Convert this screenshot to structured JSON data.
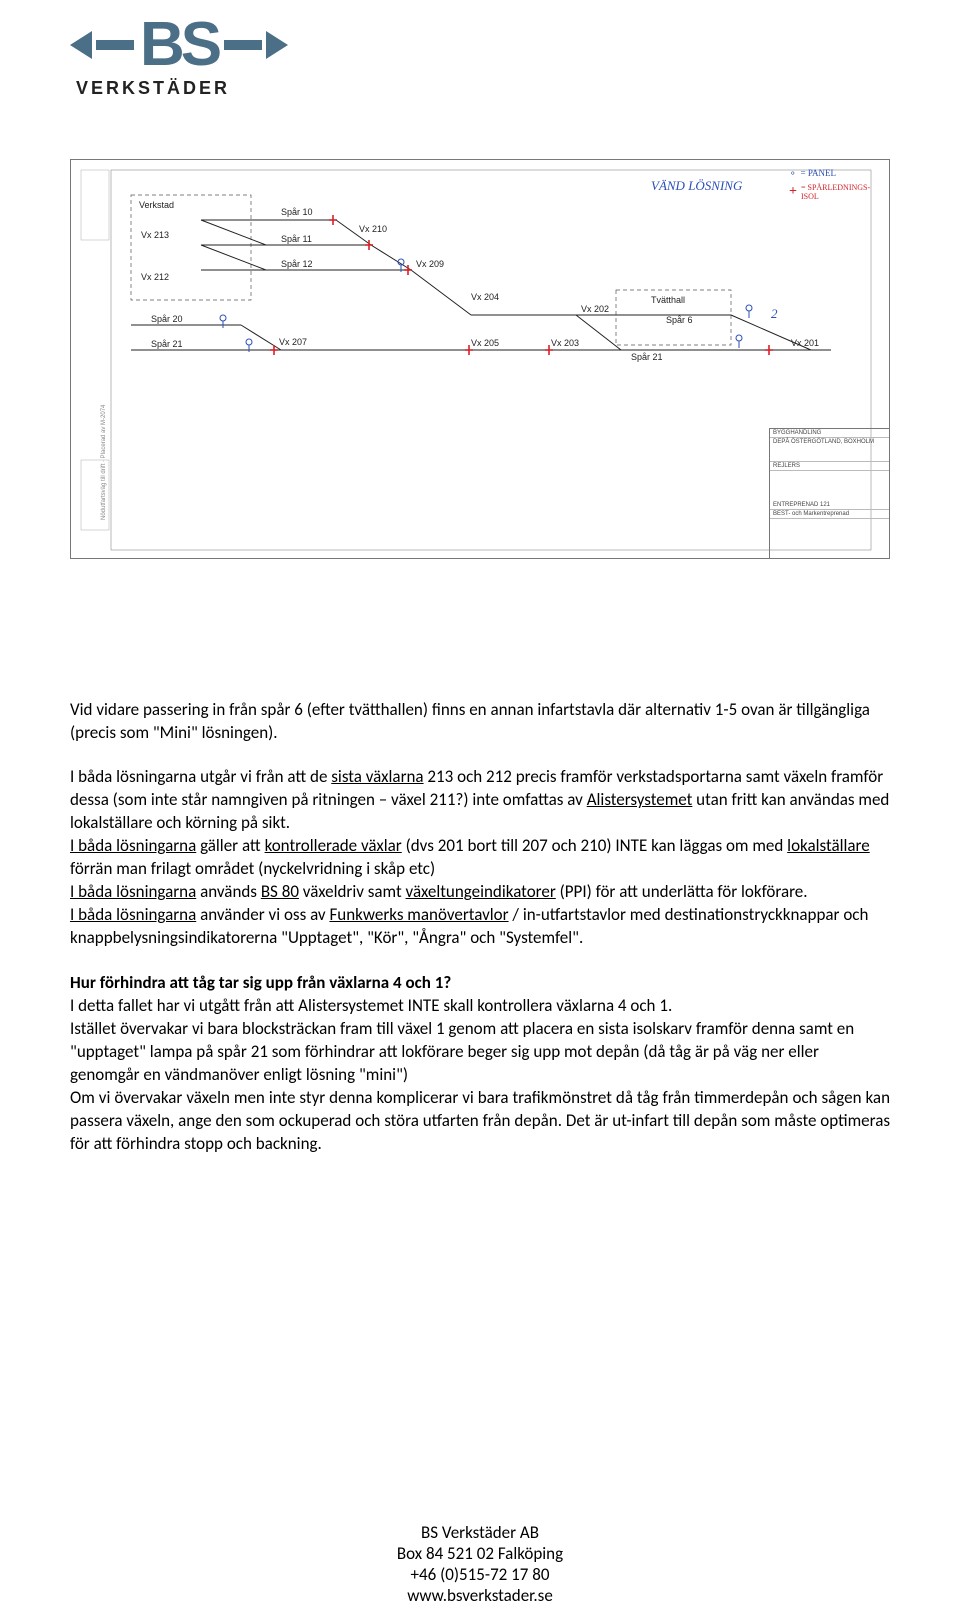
{
  "logo": {
    "bs": "BS",
    "sub": "VERKSTÄDER"
  },
  "diagram": {
    "handwritten_title": "VÄND LÖSNING",
    "labels": {
      "verkstad": "Verkstad",
      "vx213": "Vx 213",
      "vx212": "Vx 212",
      "spar10": "Spår 10",
      "spar11": "Spår 11",
      "spar12": "Spår 12",
      "vx210": "Vx 210",
      "vx209": "Vx 209",
      "vx204": "Vx 204",
      "spar20": "Spår 20",
      "spar21": "Spår 21",
      "vx207": "Vx 207",
      "vx205": "Vx 205",
      "vx203": "Vx 203",
      "vx202": "Vx 202",
      "tvatthall": "Tvätthall",
      "spar6": "Spår 6",
      "spar21b": "Spår 21",
      "vx201": "Vx 201",
      "two": "2"
    },
    "legend": {
      "panel_sym": "⚬",
      "panel": "= PANEL",
      "iso_sym": "+",
      "iso": "= SPÅRLEDNINGS-ISOL"
    },
    "titleblock": {
      "l1": "BYGGHANDLING",
      "l2": "DEPÅ ÖSTERGÖTLAND, BOXHOLM",
      "l3": "REJLERS",
      "l4": "ENTREPRENAD 121",
      "l5": "BEST- och Markentreprenad"
    },
    "side_note_left": "Nödutfartsväg till drift · Placerad av M-2074"
  },
  "para1": "Vid vidare passering in från spår 6 (efter tvätthallen) finns en annan infartstavla där alternativ 1-5 ovan är tillgängliga (precis som \"Mini\" lösningen).",
  "para2_a": "I båda lösningarna utgår vi från att de ",
  "para2_b": "sista växlarna",
  "para2_c": " 213 och 212 precis framför verkstadsportarna samt växeln framför dessa (som inte står namngiven på ritningen – växel 211?) inte omfattas av ",
  "para2_d": "Alistersystemet",
  "para2_e": " utan fritt kan användas med lokalställare och körning på sikt.",
  "para3_a": "I båda lösningarna",
  "para3_b": " gäller att ",
  "para3_c": "kontrollerade växlar",
  "para3_d": " (dvs 201 bort till 207 och 210) INTE kan läggas om med ",
  "para3_e": "lokalställare",
  "para3_f": " förrän man frilagt området (nyckelvridning i skåp etc)",
  "para4_a": "I båda lösningarna",
  "para4_b": " används ",
  "para4_c": "BS 80",
  "para4_d": " växeldriv samt ",
  "para4_e": "växeltungeindikatorer",
  "para4_f": " (PPI) för att underlätta för lokförare.",
  "para5_a": "I båda lösningarna",
  "para5_b": " använder vi oss av ",
  "para5_c": "Funkwerks manövertavlor",
  "para5_d": " / in-utfartstavlor med destinationstryckknappar och knappbelysningsindikatorerna \"Upptaget\", \"Kör\", \"Ångra\" och \"Systemfel\".",
  "heading": "Hur förhindra att tåg tar sig upp från växlarna 4 och 1?",
  "para6": "I detta fallet har vi utgått från att Alistersystemet INTE skall kontrollera växlarna 4 och 1.",
  "para7": "Istället övervakar vi bara blocksträckan fram till växel 1 genom att placera en sista isolskarv framför denna samt en \"upptaget\" lampa på spår 21 som förhindrar att lokförare beger sig upp mot depån (då tåg är på väg ner eller genomgår en vändmanöver enligt lösning \"mini\")",
  "para8": "Om vi övervakar växeln men inte styr denna komplicerar vi bara trafikmönstret då tåg från timmerdepån och sågen kan passera växeln, ange den som ockuperad och störa utfarten från depån. Det är ut-infart till depån som måste optimeras för att förhindra stopp och backning.",
  "footer": {
    "l1": "BS Verkstäder AB",
    "l2": "Box 84 521 02 Falköping",
    "l3": "+46 (0)515-72 17 80",
    "l4": "www.bsverkstader.se"
  }
}
